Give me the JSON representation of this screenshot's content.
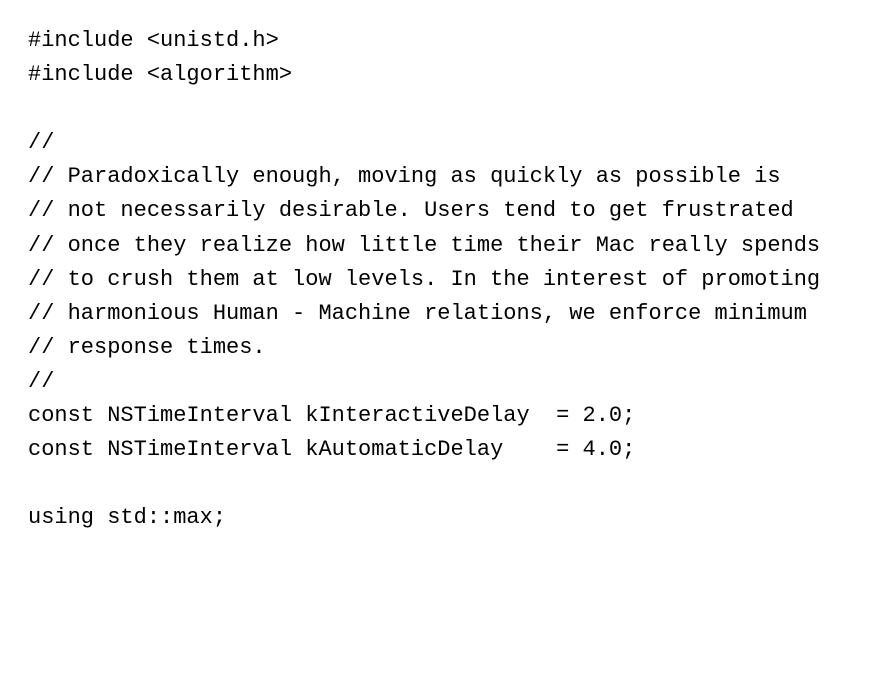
{
  "code": {
    "lines": [
      "#include &lt;unistd.h&gt;",
      "#include &lt;algorithm&gt;",
      "",
      "//",
      "// Paradoxically enough, moving as quickly as possible is",
      "// not necessarily desirable. Users tend to get frustrated",
      "// once they realize how little time their Mac really spends",
      "// to crush them at low levels. In the interest of promoting",
      "// harmonious Human - Machine relations, we enforce minimum",
      "// response times.",
      "//",
      "const NSTimeInterval kInteractiveDelay  = 2.0;",
      "const NSTimeInterval kAutomaticDelay    = 4.0;",
      "",
      "using std::max;"
    ]
  }
}
